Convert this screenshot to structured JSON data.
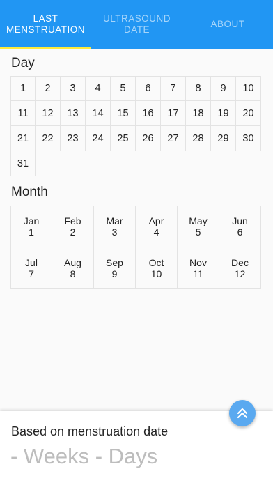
{
  "tabs": [
    {
      "label": "LAST\nMENSTRUATION",
      "active": true
    },
    {
      "label": "ULTRASOUND\nDATE",
      "active": false
    },
    {
      "label": "ABOUT",
      "active": false
    }
  ],
  "colors": {
    "primary": "#2196f3",
    "indicator": "#ffeb3b",
    "fab": "#5aa9f0"
  },
  "day_section": {
    "title": "Day",
    "days": [
      "1",
      "2",
      "3",
      "4",
      "5",
      "6",
      "7",
      "8",
      "9",
      "10",
      "11",
      "12",
      "13",
      "14",
      "15",
      "16",
      "17",
      "18",
      "19",
      "20",
      "21",
      "22",
      "23",
      "24",
      "25",
      "26",
      "27",
      "28",
      "29",
      "30",
      "31"
    ]
  },
  "month_section": {
    "title": "Month",
    "months": [
      {
        "name": "Jan",
        "number": "1"
      },
      {
        "name": "Feb",
        "number": "2"
      },
      {
        "name": "Mar",
        "number": "3"
      },
      {
        "name": "Apr",
        "number": "4"
      },
      {
        "name": "May",
        "number": "5"
      },
      {
        "name": "Jun",
        "number": "6"
      },
      {
        "name": "Jul",
        "number": "7"
      },
      {
        "name": "Aug",
        "number": "8"
      },
      {
        "name": "Sep",
        "number": "9"
      },
      {
        "name": "Oct",
        "number": "10"
      },
      {
        "name": "Nov",
        "number": "11"
      },
      {
        "name": "Dec",
        "number": "12"
      }
    ]
  },
  "result": {
    "label": "Based on menstruation date",
    "value": "- Weeks - Days"
  },
  "fab": {
    "icon": "double-chevron-up-icon"
  }
}
